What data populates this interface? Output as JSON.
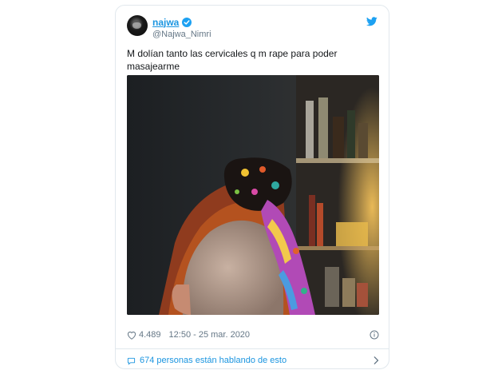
{
  "tweet": {
    "display_name": "najwa",
    "handle": "@Najwa_Nimri",
    "text": "M dolían tanto las cervicales q m rape para poder masajearme",
    "likes": "4.489",
    "timestamp": "12:50 - 25 mar. 2020",
    "conversation": "674 personas están hablando de esto"
  },
  "icons": {
    "verified": "verified-badge-icon",
    "brand": "twitter-bird-icon",
    "like": "heart-icon",
    "info": "info-icon",
    "reply": "speech-bubble-icon",
    "chevron": "chevron-right-icon"
  },
  "colors": {
    "accent": "#1da1f2",
    "link": "#1b95e0",
    "muted": "#657786",
    "border": "#e1e8ed"
  }
}
